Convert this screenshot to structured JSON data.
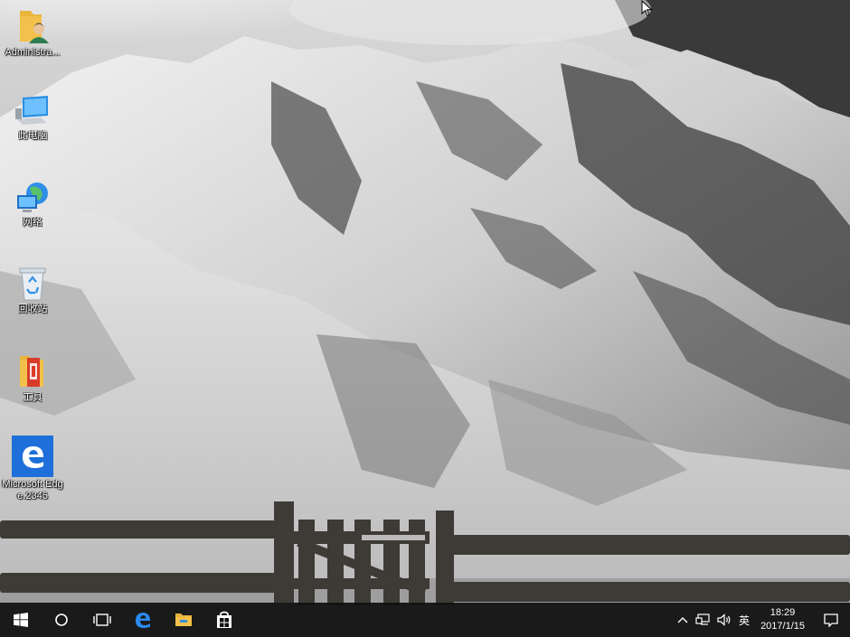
{
  "desktop_icons": [
    {
      "label": "Administra...",
      "icon": "user-folder-icon"
    },
    {
      "label": "此电脑",
      "icon": "this-pc-icon"
    },
    {
      "label": "网络",
      "icon": "network-icon"
    },
    {
      "label": "回收站",
      "icon": "recycle-bin-icon"
    },
    {
      "label": "工具",
      "icon": "tools-folder-icon"
    },
    {
      "label": "Microsoft Edge.2345",
      "icon": "edge-icon"
    }
  ],
  "taskbar": {
    "buttons": [
      "start-icon",
      "search-circle-icon",
      "task-view-icon",
      "edge-icon",
      "file-explorer-icon",
      "store-icon"
    ],
    "tray": {
      "ime": "英",
      "time": "18:29",
      "date": "2017/1/15"
    }
  },
  "colors": {
    "taskbar_bg": "#101010",
    "edge_blue": "#1e6fd9",
    "folder_yellow": "#f3c14b"
  }
}
